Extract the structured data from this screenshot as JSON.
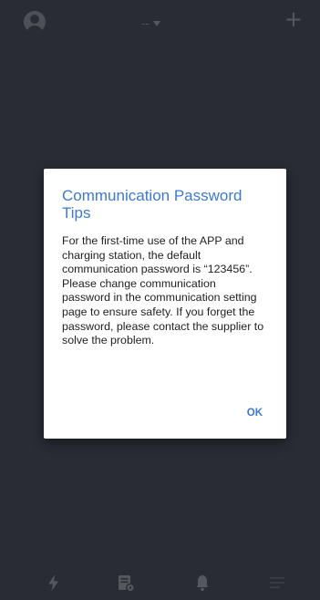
{
  "header": {
    "station_selector": "--",
    "avatar_icon": "user-avatar-icon",
    "add_icon": "plus-icon",
    "add_label": "+"
  },
  "dialog": {
    "title": "Communication Password Tips",
    "message": "For the first-time use of the APP and charging station, the default communication password is “123456”. Please change communication password in the communication setting page to ensure safety. If you forget the password, please contact the supplier to solve the problem.",
    "ok_label": "OK"
  },
  "bottom_nav": {
    "items": [
      {
        "icon": "lightning-icon"
      },
      {
        "icon": "records-icon"
      },
      {
        "icon": "bell-icon"
      },
      {
        "icon": "menu-icon"
      }
    ]
  },
  "colors": {
    "background": "#292c35",
    "accent": "#3e7ac8",
    "icon_dim": "#55575f"
  }
}
